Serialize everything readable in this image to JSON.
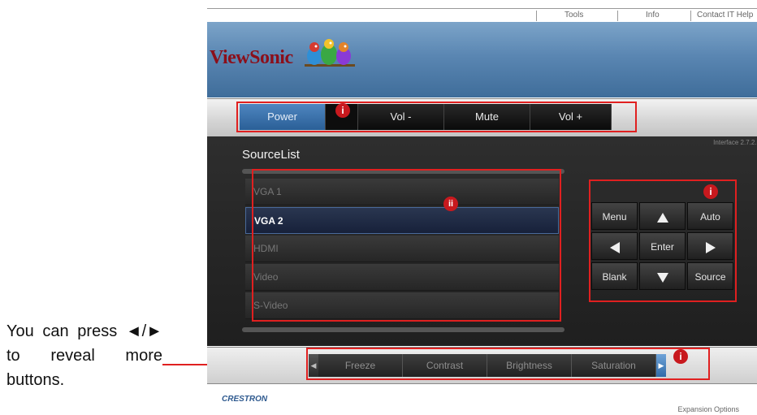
{
  "annotation": {
    "text": "You can press ◄/► to reveal more buttons."
  },
  "topbar": {
    "links": [
      "Tools",
      "Info",
      "Contact IT Help"
    ]
  },
  "brand": {
    "logo_text": "ViewSonic",
    "accent_color": "#8b0f1a"
  },
  "control_bar": {
    "buttons": [
      "Power",
      "Vol -",
      "Mute",
      "Vol +"
    ]
  },
  "interface_version": "Interface 2.7.2.6",
  "source_list": {
    "title": "SourceList",
    "items": [
      "VGA 1",
      "VGA 2",
      "HDMI",
      "Video",
      "S-Video"
    ],
    "selected": "VGA 2"
  },
  "nav_pad": {
    "menu": "Menu",
    "up_icon": "up-arrow-icon",
    "auto": "Auto",
    "left_icon": "left-arrow-icon",
    "enter": "Enter",
    "right_icon": "right-arrow-icon",
    "blank": "Blank",
    "down_icon": "down-arrow-icon",
    "source": "Source"
  },
  "bottom_bar": {
    "buttons": [
      "Freeze",
      "Contrast",
      "Brightness",
      "Saturation"
    ]
  },
  "footer": {
    "logo_text": "CRESTRON",
    "expansion": "Expansion Options"
  },
  "markers": {
    "i": "i",
    "ii": "ii"
  },
  "highlight_color": "#e02020"
}
